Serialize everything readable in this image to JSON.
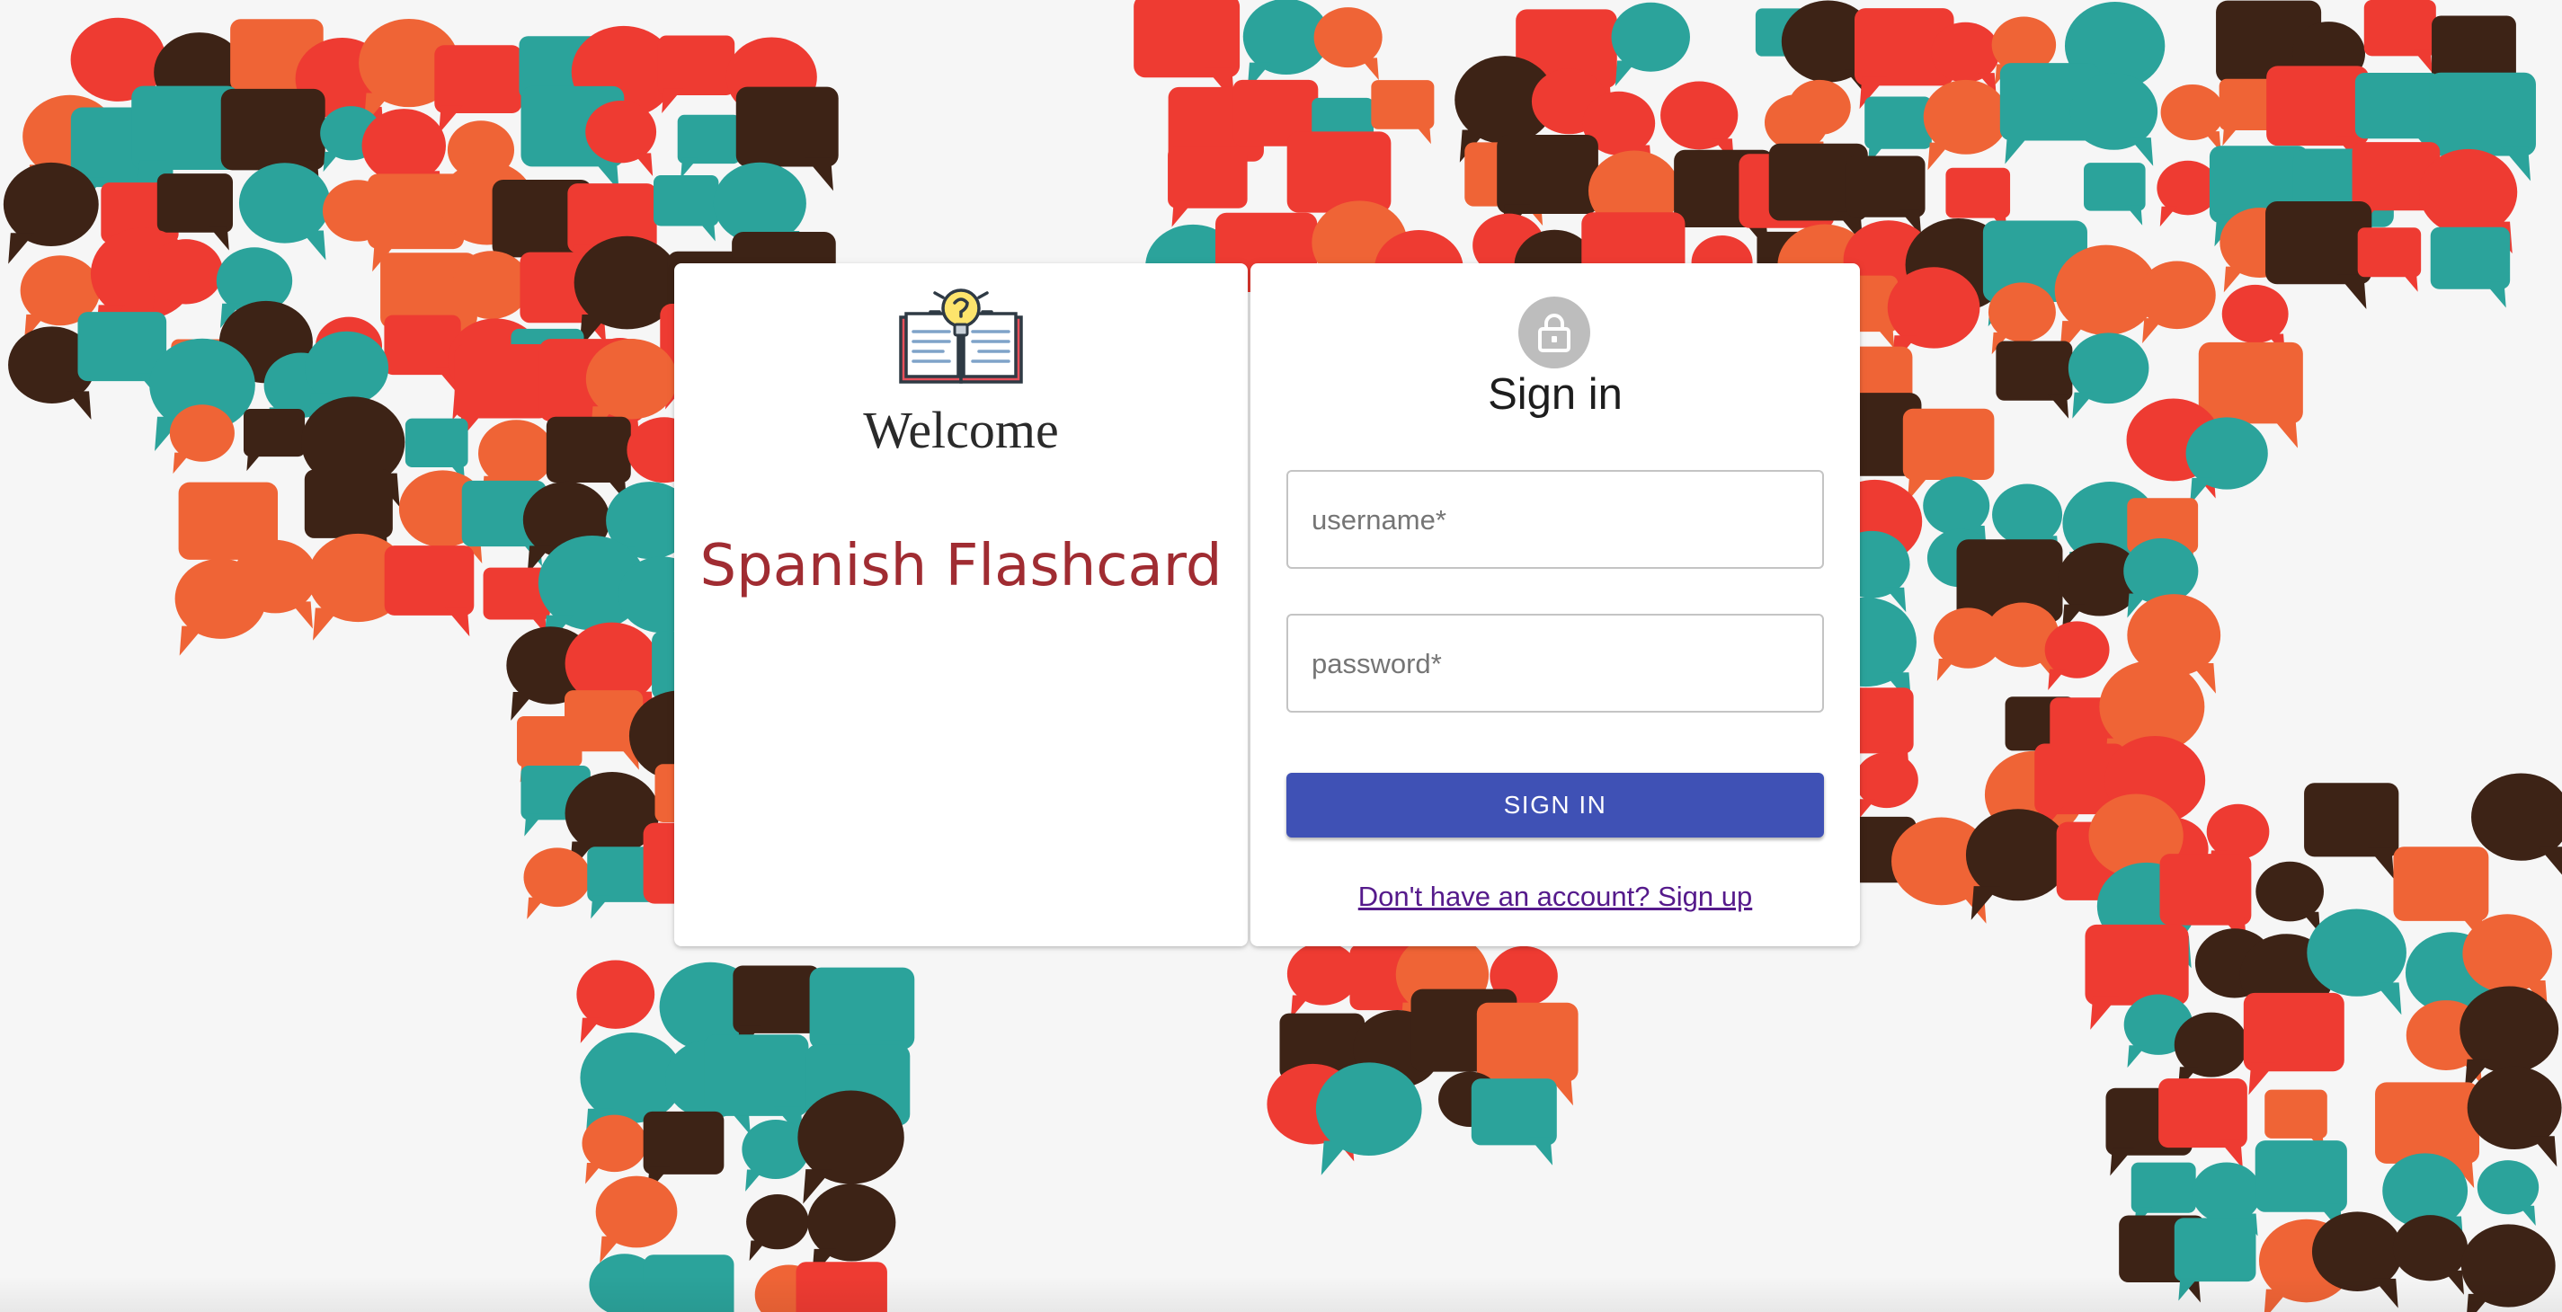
{
  "colors": {
    "teal": "#2ba39b",
    "orange": "#ef6436",
    "red": "#ee3b32",
    "dark_brown": "#3d2316",
    "background": "#f6f6f6",
    "primary_button": "#3f51b5",
    "app_title": "#a02c32",
    "link": "#551a8b"
  },
  "background": {
    "icon": "world-map-speech-bubbles-icon"
  },
  "welcome_panel": {
    "icon": "book-lightbulb-icon",
    "title": "Welcome",
    "app_name": "Spanish Flashcard"
  },
  "signin_panel": {
    "icon": "lock-icon",
    "title": "Sign in",
    "username_label": "username",
    "password_label": "password",
    "required_mark": "*",
    "username_value": "",
    "password_value": "",
    "submit_label": "SIGN IN",
    "signup_text": "Don't have an account? Sign up"
  }
}
